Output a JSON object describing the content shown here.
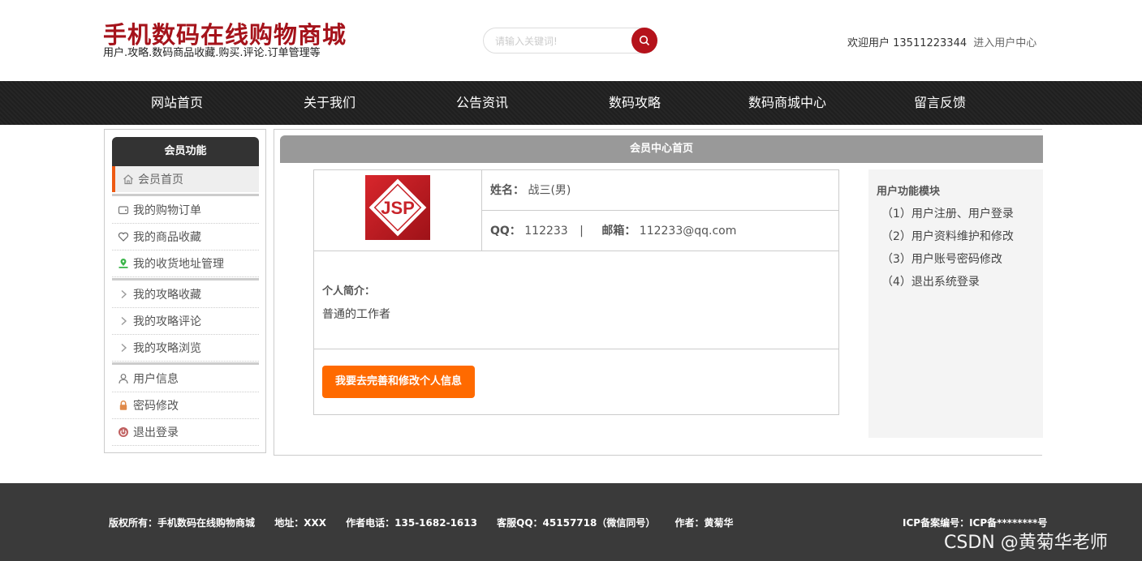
{
  "header": {
    "site_title": "手机数码在线购物商城",
    "site_subtitle": "用户.攻略.数码商品收藏.购买.评论.订单管理等",
    "search_placeholder": "请输入关键词!",
    "welcome_text": "欢迎用户 13511223344",
    "user_center_link": "进入用户中心"
  },
  "nav": {
    "items": [
      "网站首页",
      "关于我们",
      "公告资讯",
      "数码攻略",
      "数码商城中心",
      "留言反馈"
    ]
  },
  "sidebar": {
    "title": "会员功能",
    "active_item": "会员首页",
    "group1": [
      "我的购物订单",
      "我的商品收藏",
      "我的收货地址管理"
    ],
    "group2": [
      "我的攻略收藏",
      "我的攻略评论",
      "我的攻略浏览"
    ],
    "group3": [
      "用户信息",
      "密码修改",
      "退出登录"
    ]
  },
  "main": {
    "title": "会员中心首页",
    "avatar_text": "JSP",
    "name_label": "姓名：",
    "name_value": "战三(男)",
    "qq_label": "QQ：",
    "qq_value": "112233",
    "separator": "|",
    "email_label": "邮箱：",
    "email_value": "112233@qq.com",
    "intro_label": "个人简介：",
    "intro_text": "普通的工作者",
    "edit_button": "我要去完善和修改个人信息"
  },
  "func_panel": {
    "title": "用户功能模块",
    "items": [
      "（1）用户注册、用户登录",
      "（2）用户资料维护和修改",
      "（3）用户账号密码修改",
      "（4）退出系统登录"
    ]
  },
  "footer": {
    "copyright": "版权所有：手机数码在线购物商城",
    "address": "地址：XXX",
    "phone": "作者电话：135-1682-1613",
    "qq": "客服QQ：45157718（微信同号）",
    "author": "作者：黄菊华",
    "icp": "ICP备案编号：ICP备********号"
  },
  "watermark": "CSDN @黄菊华老师",
  "colors": {
    "brand_red": "#a5131b",
    "accent_orange": "#ff6a00",
    "nav_bg": "#222222",
    "footer_bg": "#3a3a3a"
  }
}
